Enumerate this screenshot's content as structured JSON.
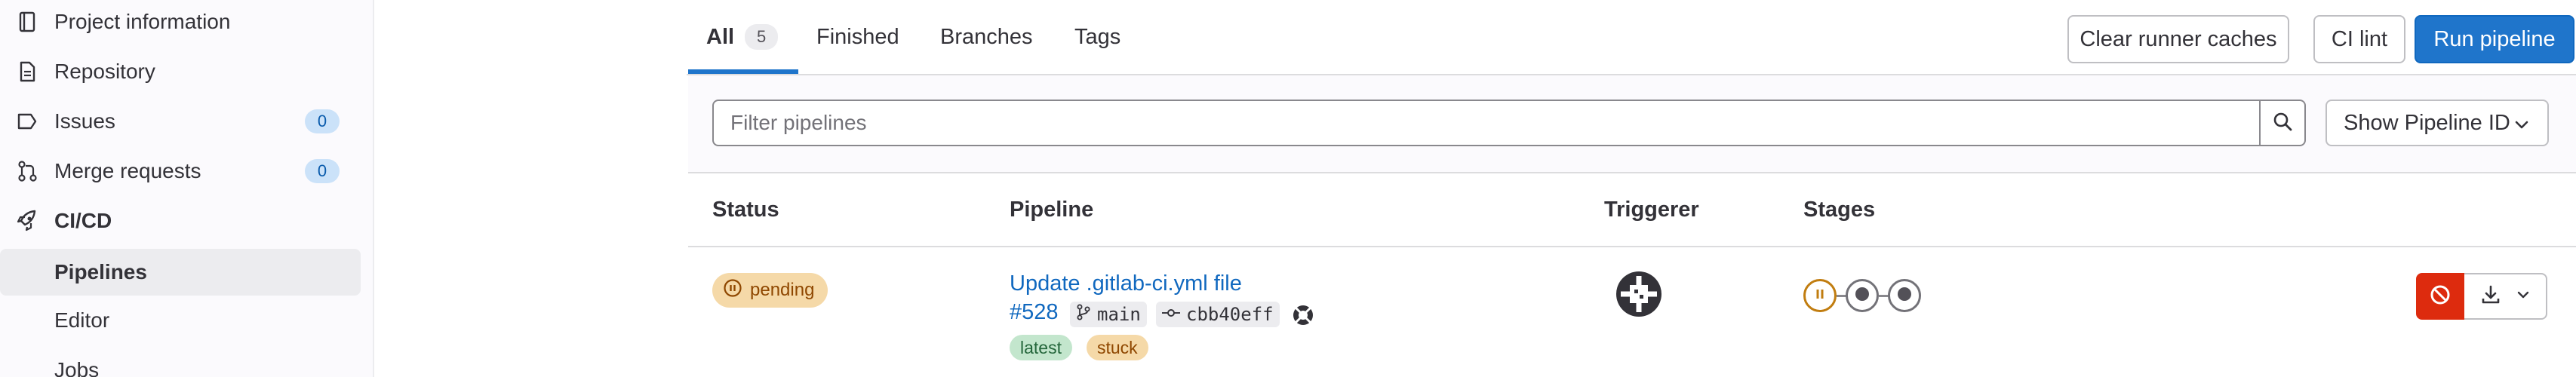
{
  "sidebar": {
    "items": [
      {
        "label": "Project information",
        "icon": "project-info-icon"
      },
      {
        "label": "Repository",
        "icon": "document-icon"
      },
      {
        "label": "Issues",
        "icon": "issues-icon",
        "count": "0"
      },
      {
        "label": "Merge requests",
        "icon": "merge-request-icon",
        "count": "0"
      },
      {
        "label": "CI/CD",
        "icon": "rocket-icon"
      },
      {
        "label": "Pipelines"
      },
      {
        "label": "Editor"
      },
      {
        "label": "Jobs"
      }
    ]
  },
  "tabs": [
    {
      "label": "All",
      "count": "5",
      "active": true
    },
    {
      "label": "Finished"
    },
    {
      "label": "Branches"
    },
    {
      "label": "Tags"
    }
  ],
  "actions": {
    "clear_caches": "Clear runner caches",
    "ci_lint": "CI lint",
    "run_pipeline": "Run pipeline"
  },
  "filter": {
    "placeholder": "Filter pipelines",
    "show_id": "Show Pipeline ID"
  },
  "table": {
    "headers": [
      "Status",
      "Pipeline",
      "Triggerer",
      "Stages"
    ],
    "rows": [
      {
        "status": "pending",
        "title": "Update .gitlab-ci.yml file",
        "id": "#528",
        "branch": "main",
        "commit": "cbb40eff",
        "tags": [
          "latest",
          "stuck"
        ],
        "stages": [
          "pending",
          "created",
          "created"
        ]
      }
    ]
  },
  "colors": {
    "accent": "#1f75cb",
    "danger": "#dd2b0e",
    "pending_bg": "#f5d9a8",
    "pending_fg": "#8f4700",
    "latest_bg": "#c3e6cd"
  }
}
